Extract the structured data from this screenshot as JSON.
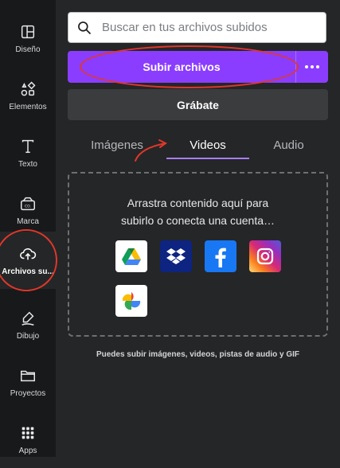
{
  "sidebar": {
    "items": [
      {
        "label": "Diseño",
        "icon": "layout-icon"
      },
      {
        "label": "Elementos",
        "icon": "shapes-icon"
      },
      {
        "label": "Texto",
        "icon": "text-icon"
      },
      {
        "label": "Marca",
        "icon": "brand-icon"
      },
      {
        "label": "Archivos su...",
        "icon": "cloud-upload-icon",
        "active": true
      },
      {
        "label": "Dibujo",
        "icon": "draw-icon"
      },
      {
        "label": "Proyectos",
        "icon": "folder-icon"
      },
      {
        "label": "Apps",
        "icon": "apps-grid-icon"
      }
    ]
  },
  "search": {
    "placeholder": "Buscar en tus archivos subidos"
  },
  "upload": {
    "label": "Subir archivos"
  },
  "record": {
    "label": "Grábate"
  },
  "tabs": [
    {
      "label": "Imágenes"
    },
    {
      "label": "Videos",
      "active": true
    },
    {
      "label": "Audio"
    }
  ],
  "dropzone": {
    "line1": "Arrastra contenido aquí para",
    "line2": "subirlo o conecta una cuenta…",
    "sources": [
      "google-drive-icon",
      "dropbox-icon",
      "facebook-icon",
      "instagram-icon",
      "google-photos-icon"
    ]
  },
  "hint": "Puedes subir imágenes, videos, pistas de audio y GIF",
  "colors": {
    "accent": "#8b3dff",
    "annotation": "#e0372b",
    "panel": "#252627",
    "rail": "#18191b"
  }
}
